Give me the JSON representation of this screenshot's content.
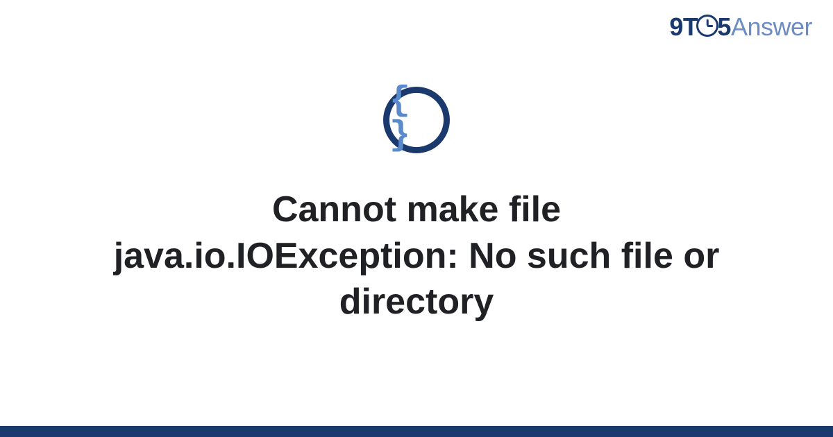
{
  "brand": {
    "part1": "9T",
    "part2": "5",
    "part3": "Answer"
  },
  "icon": {
    "symbol": "{ }",
    "name": "code-braces"
  },
  "title": "Cannot make file java.io.IOException: No such file or directory",
  "colors": {
    "primary": "#1a3a6e",
    "secondary": "#6b8cc4",
    "accent": "#5a89cc",
    "text": "#202124"
  }
}
